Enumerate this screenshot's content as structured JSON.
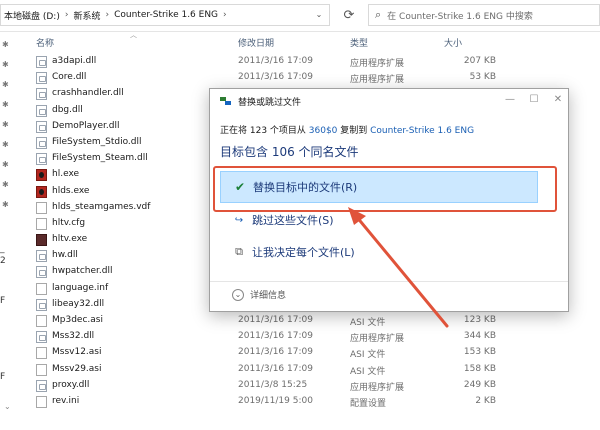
{
  "address_bar": {
    "breadcrumbs": [
      "本地磁盘 (D:)",
      "新系统",
      "Counter-Strike 1.6 ENG"
    ],
    "search_placeholder": "在 Counter-Strike 1.6 ENG 中搜索"
  },
  "columns": {
    "name": "名称",
    "date": "修改日期",
    "type": "类型",
    "size": "大小"
  },
  "files": [
    {
      "name": "a3dapi.dll",
      "date": "2011/3/16 17:09",
      "type": "应用程序扩展",
      "size": "207 KB",
      "icon": "dll-icon"
    },
    {
      "name": "Core.dll",
      "date": "2011/3/16 17:09",
      "type": "应用程序扩展",
      "size": "53 KB",
      "icon": "dll-icon"
    },
    {
      "name": "crashhandler.dll",
      "date": "",
      "type": "",
      "size": "",
      "icon": "dll-icon"
    },
    {
      "name": "dbg.dll",
      "date": "",
      "type": "",
      "size": "",
      "icon": "dll-icon"
    },
    {
      "name": "DemoPlayer.dll",
      "date": "",
      "type": "",
      "size": "",
      "icon": "dll-icon"
    },
    {
      "name": "FileSystem_Stdio.dll",
      "date": "",
      "type": "",
      "size": "",
      "icon": "dll-icon"
    },
    {
      "name": "FileSystem_Steam.dll",
      "date": "",
      "type": "",
      "size": "",
      "icon": "dll-icon"
    },
    {
      "name": "hl.exe",
      "date": "",
      "type": "",
      "size": "",
      "icon": "hl-exe-icon"
    },
    {
      "name": "hlds.exe",
      "date": "",
      "type": "",
      "size": "",
      "icon": "hl-exe-icon"
    },
    {
      "name": "hlds_steamgames.vdf",
      "date": "",
      "type": "",
      "size": "",
      "icon": "file-icon"
    },
    {
      "name": "hltv.cfg",
      "date": "",
      "type": "",
      "size": "",
      "icon": "file-icon"
    },
    {
      "name": "hltv.exe",
      "date": "",
      "type": "",
      "size": "",
      "icon": "hltv-exe-icon"
    },
    {
      "name": "hw.dll",
      "date": "",
      "type": "",
      "size": "",
      "icon": "dll-icon"
    },
    {
      "name": "hwpatcher.dll",
      "date": "",
      "type": "",
      "size": "",
      "icon": "dll-icon"
    },
    {
      "name": "language.inf",
      "date": "",
      "type": "",
      "size": "",
      "icon": "file-icon"
    },
    {
      "name": "libeay32.dll",
      "date": "",
      "type": "",
      "size": "",
      "icon": "dll-icon"
    },
    {
      "name": "Mp3dec.asi",
      "date": "2011/3/16 17:09",
      "type": "ASI 文件",
      "size": "123 KB",
      "icon": "file-icon"
    },
    {
      "name": "Mss32.dll",
      "date": "2011/3/16 17:09",
      "type": "应用程序扩展",
      "size": "344 KB",
      "icon": "dll-icon"
    },
    {
      "name": "Mssv12.asi",
      "date": "2011/3/16 17:09",
      "type": "ASI 文件",
      "size": "153 KB",
      "icon": "file-icon"
    },
    {
      "name": "Mssv29.asi",
      "date": "2011/3/16 17:09",
      "type": "ASI 文件",
      "size": "158 KB",
      "icon": "file-icon"
    },
    {
      "name": "proxy.dll",
      "date": "2011/3/8 15:25",
      "type": "应用程序扩展",
      "size": "249 KB",
      "icon": "dll-icon"
    },
    {
      "name": "rev.ini",
      "date": "2019/11/19 5:00",
      "type": "配置设置",
      "size": "2 KB",
      "icon": "file-icon"
    }
  ],
  "dialog": {
    "title": "替换或跳过文件",
    "progress_prefix": "正在将 123 个项目从 ",
    "progress_source": "360$0",
    "progress_middle": " 复制到 ",
    "progress_dest": "Counter-Strike 1.6 ENG",
    "headline": "目标包含 106 个同名文件",
    "option_replace": "替换目标中的文件(R)",
    "option_skip": "跳过这些文件(S)",
    "option_decide": "让我决定每个文件(L)",
    "details": "详细信息"
  },
  "colors": {
    "accent_blue": "#1a5fb4",
    "selected_bg": "#cce8ff",
    "annotation_red": "#e0533a",
    "headline_blue": "#1c3a7a"
  }
}
